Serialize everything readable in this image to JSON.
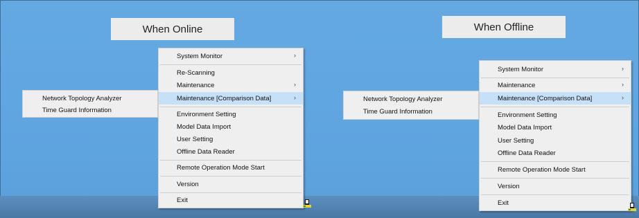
{
  "online": {
    "title": "When Online",
    "items": [
      {
        "label": "System Monitor",
        "arrow": "›"
      },
      {
        "label": "Re-Scanning",
        "arrow": ""
      },
      {
        "label": "Maintenance",
        "arrow": "›"
      },
      {
        "label": "Maintenance [Comparison Data]",
        "arrow": "›"
      },
      {
        "label": "Environment Setting",
        "arrow": ""
      },
      {
        "label": "Model Data Import",
        "arrow": ""
      },
      {
        "label": "User Setting",
        "arrow": ""
      },
      {
        "label": "Offline Data Reader",
        "arrow": ""
      },
      {
        "label": "Remote Operation Mode Start",
        "arrow": ""
      },
      {
        "label": "Version",
        "arrow": ""
      },
      {
        "label": "Exit",
        "arrow": ""
      }
    ],
    "submenu": [
      "Network Topology Analyzer",
      "Time Guard Information"
    ]
  },
  "offline": {
    "title": "When Offline",
    "items": [
      {
        "label": "System Monitor",
        "arrow": "›"
      },
      {
        "label": "Maintenance",
        "arrow": "›"
      },
      {
        "label": "Maintenance [Comparison Data]",
        "arrow": "›"
      },
      {
        "label": "Environment Setting",
        "arrow": ""
      },
      {
        "label": "Model Data Import",
        "arrow": ""
      },
      {
        "label": "User Setting",
        "arrow": ""
      },
      {
        "label": "Offline Data Reader",
        "arrow": ""
      },
      {
        "label": "Remote Operation Mode Start",
        "arrow": ""
      },
      {
        "label": "Version",
        "arrow": ""
      },
      {
        "label": "Exit",
        "arrow": ""
      }
    ],
    "submenu": [
      "Network Topology Analyzer",
      "Time Guard Information"
    ]
  },
  "colors": {
    "desktop": "#5ea4df",
    "highlight": "#c6e0f7",
    "menu_bg": "#efefef"
  },
  "icons": {
    "tray": "tray-app-icon",
    "submenu_arrow": "chevron-right-icon"
  }
}
